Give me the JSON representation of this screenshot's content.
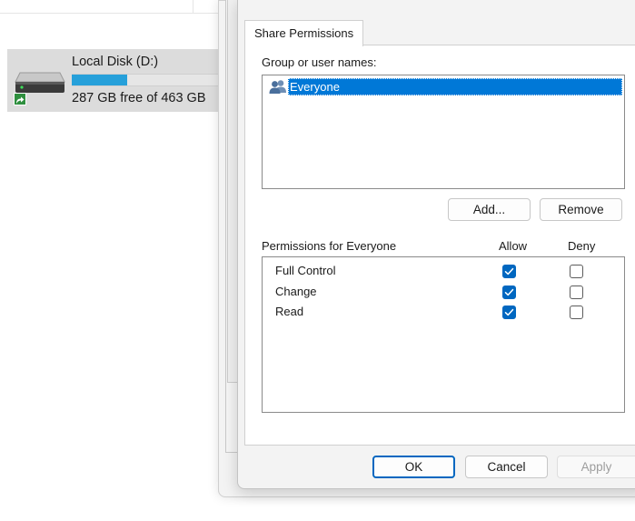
{
  "explorer": {
    "drive": {
      "name": "Local Disk (D:)",
      "free_text": "287 GB free of 463 GB",
      "used_fraction": 0.38,
      "icon": "hard-drive-icon",
      "overlay_icon": "shared-arrow-icon"
    }
  },
  "dialog": {
    "tab_label": "Share Permissions",
    "group_label": "Group or user names:",
    "users": [
      {
        "name": "Everyone",
        "icon": "users-icon",
        "selected": true
      }
    ],
    "add_label": "Add...",
    "remove_label": "Remove",
    "permissions_header": "Permissions for Everyone",
    "allow_header": "Allow",
    "deny_header": "Deny",
    "permissions": [
      {
        "name": "Full Control",
        "allow": true,
        "deny": false
      },
      {
        "name": "Change",
        "allow": true,
        "deny": false
      },
      {
        "name": "Read",
        "allow": true,
        "deny": false
      }
    ],
    "ok_label": "OK",
    "cancel_label": "Cancel",
    "apply_label": "Apply"
  },
  "colors": {
    "accent": "#0067c0",
    "selection": "#0078d7",
    "drive_bar": "#26a0da"
  }
}
